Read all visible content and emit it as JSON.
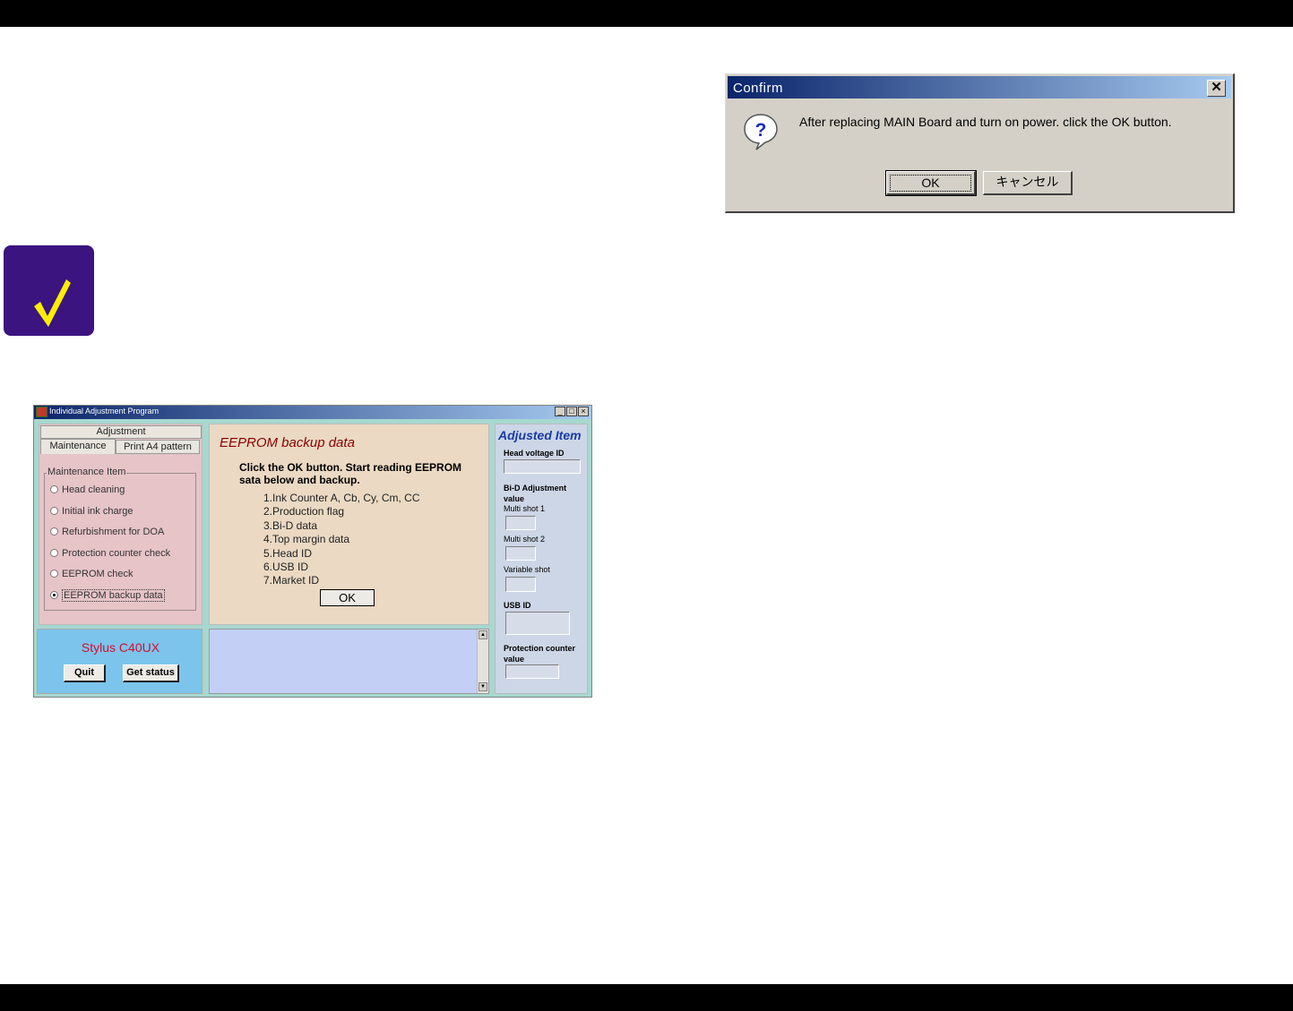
{
  "confirm": {
    "title": "Confirm",
    "close_glyph": "✕",
    "message": "After replacing MAIN Board and turn on power. click the OK button.",
    "ok_label": "OK",
    "cancel_label": "キャンセル",
    "icon": "question-icon"
  },
  "note_icon": "checkmark-icon",
  "window": {
    "title": "Individual Adjustment Program",
    "controls": {
      "minimize": "_",
      "maximize": "□",
      "close": "×"
    },
    "tabs": {
      "adjustment": "Adjustment",
      "maintenance": "Maintenance",
      "print": "Print A4 pattern"
    },
    "maintenance": {
      "group_label": "Maintenance Item",
      "items": [
        {
          "label": "Head cleaning",
          "selected": false
        },
        {
          "label": "Initial ink charge",
          "selected": false
        },
        {
          "label": "Refurbishment for DOA",
          "selected": false
        },
        {
          "label": "Protection counter check",
          "selected": false
        },
        {
          "label": "EEPROM check",
          "selected": false
        },
        {
          "label": "EEPROM backup data",
          "selected": true
        }
      ]
    },
    "main": {
      "heading": "EEPROM backup data",
      "instruction": "Click the OK button. Start reading EEPROM sata below and backup.",
      "items": [
        "1.Ink Counter A, Cb, Cy, Cm, CC",
        "2.Production flag",
        "3.Bi-D data",
        "4.Top margin data",
        "5.Head ID",
        "6.USB ID",
        "7.Market ID"
      ],
      "ok_label": "OK"
    },
    "adjusted": {
      "heading": "Adjusted Item",
      "head_voltage": "Head voltage ID",
      "bid": "Bi-D Adjustment value",
      "multi1": "Multi shot 1",
      "multi2": "Multi shot 2",
      "variable": "Variable shot",
      "usb": "USB ID",
      "protection": "Protection counter value"
    },
    "model": "Stylus C40UX",
    "quit_label": "Quit",
    "status_label": "Get status",
    "scroll": {
      "up": "▲",
      "down": "▼"
    }
  }
}
